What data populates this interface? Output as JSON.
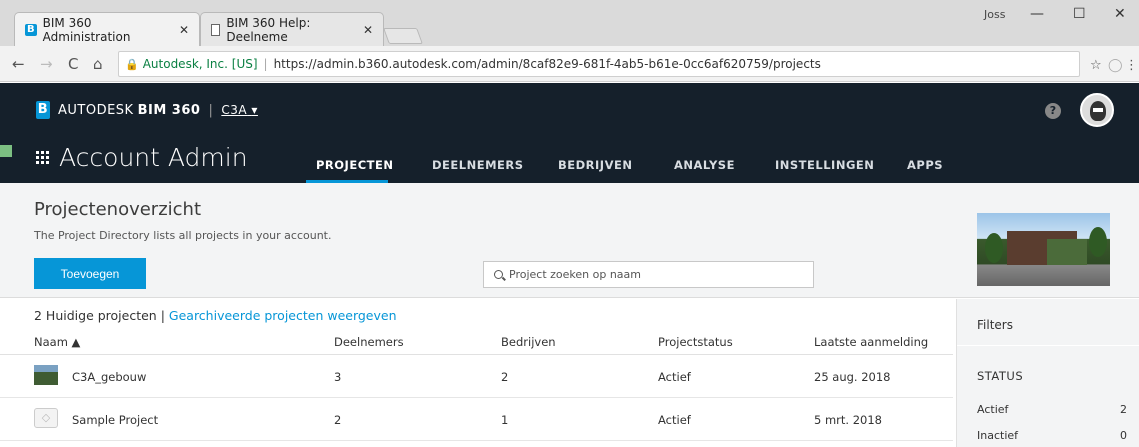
{
  "browser": {
    "tabs": [
      {
        "title": "BIM 360 Administration",
        "close": "✕"
      },
      {
        "title": "BIM 360 Help: Deelneme",
        "close": "✕"
      }
    ],
    "user": "Joss",
    "controls": {
      "minimize": "—",
      "maximize": "☐",
      "close": "✕"
    },
    "nav": {
      "back": "←",
      "forward": "→",
      "reload": "C",
      "home": "⌂"
    },
    "address": {
      "secure_label": "Autodesk, Inc. [US]",
      "url": "https://admin.b360.autodesk.com/admin/8caf82e9-681f-4ab5-b61e-0cc6af620759/projects"
    },
    "star": "☆",
    "menu": "⋮"
  },
  "header": {
    "brand_prefix": "AUTODESK",
    "brand_product": "BIM 360",
    "account": "C3A",
    "account_caret": "▾",
    "help": "?",
    "app_title": "Account Admin",
    "nav": [
      "PROJECTEN",
      "DEELNEMERS",
      "BEDRIJVEN",
      "ANALYSE",
      "INSTELLINGEN",
      "APPS"
    ]
  },
  "page": {
    "title": "Projectenoverzicht",
    "subtitle": "The Project Directory lists all projects in your account.",
    "add_button": "Toevoegen",
    "search_placeholder": "Project zoeken op naam"
  },
  "list": {
    "count_label": "2 Huidige projecten |",
    "archived_link": "Gearchiveerde projecten weergeven",
    "columns": [
      "Naam ▲",
      "Deelnemers",
      "Bedrijven",
      "Projectstatus",
      "Laatste aanmelding"
    ],
    "rows": [
      {
        "name": "C3A_gebouw",
        "members": "3",
        "companies": "2",
        "status": "Actief",
        "last_login": "25 aug. 2018"
      },
      {
        "name": "Sample Project",
        "members": "2",
        "companies": "1",
        "status": "Actief",
        "last_login": "5 mrt. 2018"
      }
    ]
  },
  "filters": {
    "title": "Filters",
    "status_heading": "STATUS",
    "items": [
      {
        "label": "Actief",
        "count": "2"
      },
      {
        "label": "Inactief",
        "count": "0"
      }
    ]
  }
}
